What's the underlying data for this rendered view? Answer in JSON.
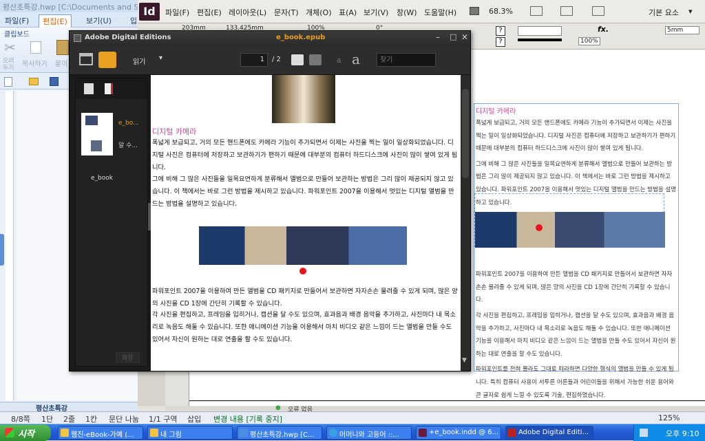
{
  "hwp": {
    "title": "평산초특강.hwp [C:\\Documents and Se",
    "menu": [
      "파일(F)",
      "편집(E)",
      "보기(U)",
      "입"
    ],
    "ribbon": {
      "clipboard": "클립보드",
      "undo": "오려\n두기",
      "copy": "복사하기",
      "paste": "붙이"
    },
    "doc_tab": "평산초특강",
    "status": [
      "8/8쪽",
      "1단",
      "2줄",
      "1칸",
      "문단 나눔",
      "1/1 구역",
      "삽입",
      "변경 내용 [기록 중지]"
    ]
  },
  "indesign": {
    "logo": "Id",
    "menu": [
      "파일(F)",
      "편집(E)",
      "레이아웃(L)",
      "문자(T)",
      "개체(O)",
      "표(A)",
      "보기(V)",
      "창(W)",
      "도움말(H)"
    ],
    "zoom": "68.3%",
    "workspace": "기본 요소",
    "ctrl": {
      "x": "203mm",
      "w": "133.425mm",
      "pct1": "100%",
      "angle": "0°",
      "pct2": "100%",
      "stroke": "5mm"
    },
    "frame": {
      "title": "디지털 카메라",
      "p1": "폭넓게 보급되고, 거의 모든 핸드폰에도 카메라 기능이 추가되면서 이제는 사진을 찍는 일이 일상화되었습니다. 디지털 사진은 컴퓨터에 저장하고 보관하기가 편하기 때문에 대부분의 컴퓨터 하드디스크에 사진이 많이 쌓여 있게 됩니다.",
      "p2": "그에 비해 그 많은 사진들을 일목요연하게 분류해서 앨범으로 만들어 보관하는 방법은 그리 많이 제공되지 않고 있습니다. 이 책에서는 바로 그런 방법을 제시하고 있습니다. 파워포인트 2007을 이용해서 멋있는 디지털 앨범을 만드는 방법을 설명하고 있습니다.",
      "p3": "파워포인트 2007을 이용하여 만든 앨범을 CD 패키지로 만들어서 보관하면 자자손손 물려줄 수 있게 되며, 많은 양의 사진을 CD 1장에 간단히 기록할 수 있습니다.",
      "p4": "각 사진을 편집하고, 프레임을 입히거나, 캡션을 달 수도 있으며, 효과음과 배경 음악을 추가하고, 사진마다 내 목소리로 녹음도 해둘 수 있습니다. 또한 애니메이션 기능을 이용해서 마치 비디오 같은 느낌이 드는 앨범을 만들 수도 있어서 자신이 원하는 대로 연출을 할 수도 있습니다.",
      "p5": "파워포인트를 전혀 몰라도 그대로 따라하면 다양한 형식의 앨범을 만들 수 있게 됩니다. 특히 컴퓨터 사용이 서투른 어른들과 어린이들을 위해서 가능한 쉬운 용어와 큰 글자로 쉽게 느낄 수 있도록 기술, 편집하였습니다."
    },
    "status": "오류 없음",
    "zoom_bottom": "125%"
  },
  "ade": {
    "app_title": "Adobe Digital Editions",
    "book_title": "e_book.epub",
    "reading_mode": "읽기",
    "page_current": "1",
    "page_total": "/ 2",
    "font_small": "a",
    "font_large": "a",
    "search_placeholder": "찾기",
    "library": {
      "item_short": "e_bo...",
      "item_author": "알 수...",
      "item_label": "e_book",
      "collapse": "확장"
    },
    "content": {
      "heading": "디지털 카메라",
      "p1": "폭넓게 보급되고, 거의 모든 핸드폰에도 카메라 기능이 추가되면서 이제는 사진을 찍는 일이 일상화되었습니다. 디지털 사진은 컴퓨터에 저장하고 보관하기가 편하기 때문에 대부분의 컴퓨터 하드디스크에 사진이 많이 쌓여 있게 됩니다.",
      "p2": "그에 비해 그 많은 사진들을 일목요연하게 분류해서 앨범으로 만들어 보관하는 방법은 그리 많이 제공되지 않고 있습니다. 이 책에서는 바로 그런 방법을 제시하고 있습니다. 파워포인트 2007을 이용해서 멋있는 디지털 앨범을 만드는 방법을 설명하고 있습니다.",
      "p3": "파워포인트 2007을 이용하여 만든 앨범을 CD 패키지로 만들어서 보관하면 자자손손 물려줄 수 있게 되며, 많은 양의 사진을 CD 1장에 간단히 기록할 수 있습니다.",
      "p4": "각 사진을 편집하고, 프레임을 입히거나, 캡션을 달 수도 있으며, 효과음과 배경 음악을 추가하고, 사진마다 내 목소리로 녹음도 해둘 수 있습니다. 또한 애니메이션 기능을 이용해서 마치 비디오 같은 느낌이 드는 앨범을 만들 수도 있어서 자신이 원하는 대로 연출을 할 수도 있습니다."
    }
  },
  "taskbar": {
    "start": "시작",
    "items": [
      {
        "label": "웹진-eBook-가예 (...",
        "color": "#f4c542"
      },
      {
        "label": "내 그림",
        "color": "#f4c542"
      },
      {
        "label": "평산초특강.hwp [C...",
        "color": "#4a8fe0"
      },
      {
        "label": "머머니와 고등어 ::...",
        "color": "#3aa0e0"
      },
      {
        "label": "+e_book.indd @ 6...",
        "color": "#6a1a3a"
      },
      {
        "label": "Adobe Digital Editi...",
        "color": "#c02020"
      }
    ],
    "time": "오후 9:10"
  },
  "colors": {
    "heading_pink": "#c04a96",
    "ade_title_orange": "#e8a020",
    "marker_red": "#e8141e"
  }
}
